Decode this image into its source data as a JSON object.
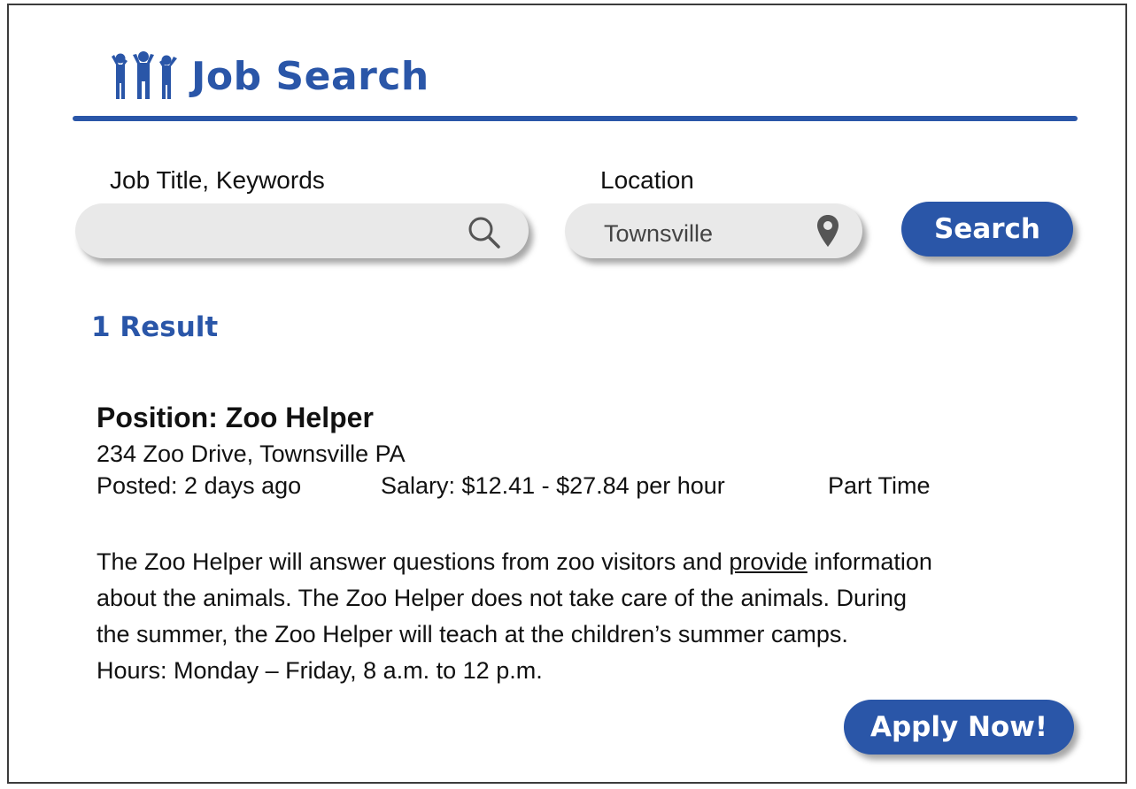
{
  "header": {
    "title": "Job Search",
    "logo_icon": "people-group-icon"
  },
  "search": {
    "keywords_label": "Job Title, Keywords",
    "keywords_value": "",
    "keywords_icon": "search-icon",
    "location_label": "Location",
    "location_value": "Townsville",
    "location_icon": "map-pin-icon",
    "button_label": "Search"
  },
  "results": {
    "count_text": "1 Result",
    "items": [
      {
        "position": "Position: Zoo Helper",
        "address": "234 Zoo Drive, Townsville PA",
        "posted": "Posted: 2 days ago",
        "salary": "Salary: $12.41 - $27.84 per hour",
        "type": "Part Time",
        "description": {
          "line1_a": "The Zoo Helper will answer questions from zoo visitors and ",
          "line1_link": "provide",
          "line1_b": " information",
          "line2": "about the animals. The Zoo Helper does not take care of the animals. During",
          "line3": "the summer, the Zoo Helper will teach at the children’s summer camps.",
          "line4": "Hours: Monday – Friday, 8 a.m. to 12 p.m."
        },
        "apply_label": "Apply Now!"
      }
    ]
  },
  "colors": {
    "brand": "#2a56a8",
    "field_bg": "#e9e9e9"
  }
}
